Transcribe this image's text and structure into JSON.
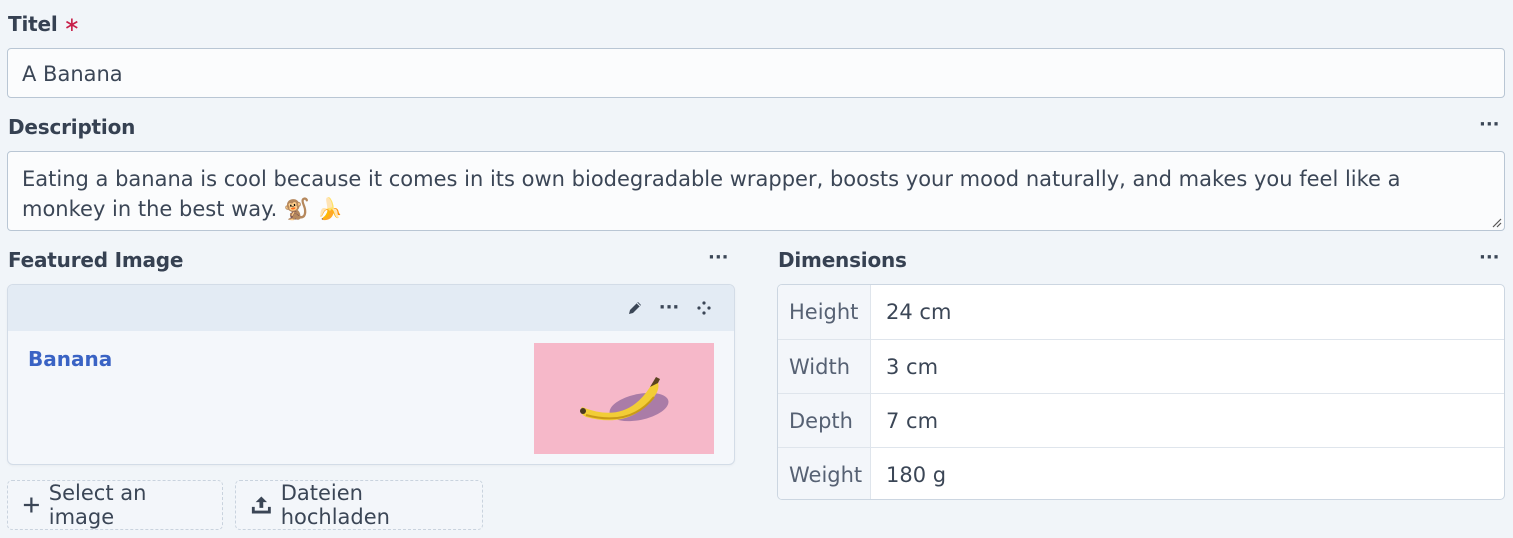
{
  "title_field": {
    "label": "Titel",
    "required_mark": "∗",
    "value": "A Banana"
  },
  "description_field": {
    "label": "Description",
    "value": "Eating a banana is cool because it comes in its own biodegradable wrapper, boosts your mood naturally, and makes you feel like a monkey in the best way. 🐒 🍌",
    "menu_icon": "more-horizontal-icon"
  },
  "featured_image": {
    "label": "Featured Image",
    "menu_icon": "more-horizontal-icon",
    "card": {
      "link_text": "Banana",
      "toolbar_icons": [
        "pencil-icon",
        "more-horizontal-icon",
        "drag-handle-icon"
      ],
      "thumbnail_background": "#f6b8c9"
    },
    "buttons": {
      "select_label": "Select an image",
      "upload_label": "Dateien hochladen"
    }
  },
  "dimensions": {
    "label": "Dimensions",
    "menu_icon": "more-horizontal-icon",
    "rows": [
      {
        "key": "Height",
        "value": "24 cm"
      },
      {
        "key": "Width",
        "value": "3 cm"
      },
      {
        "key": "Depth",
        "value": "7 cm"
      },
      {
        "key": "Weight",
        "value": "180 g"
      }
    ]
  },
  "colors": {
    "background": "#f1f5f9",
    "required": "#c8204a",
    "link": "#3a63c4",
    "text": "#3b4656"
  }
}
